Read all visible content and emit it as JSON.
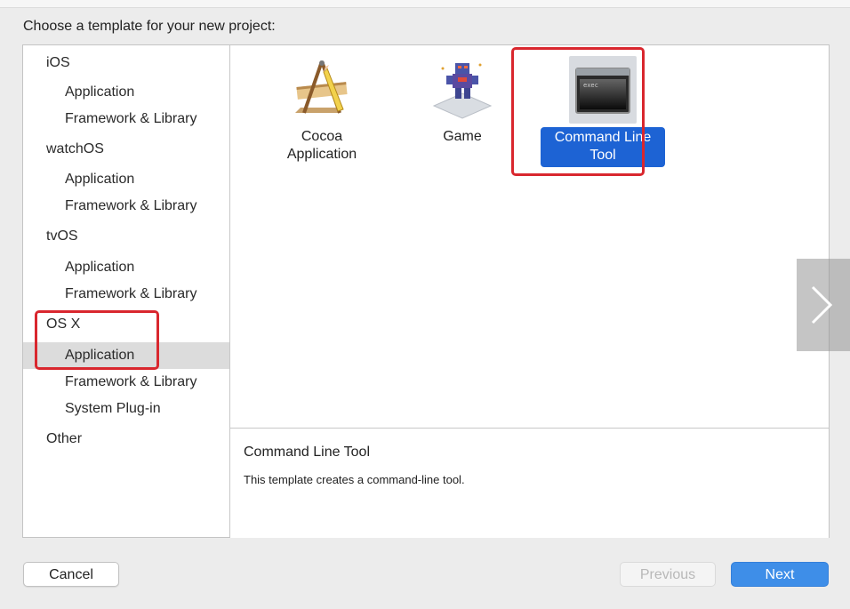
{
  "dialog": {
    "prompt": "Choose a template for your new project:"
  },
  "sidebar": {
    "items": [
      {
        "label": "iOS",
        "kind": "category"
      },
      {
        "label": "Application",
        "kind": "sub"
      },
      {
        "label": "Framework & Library",
        "kind": "sub"
      },
      {
        "label": "watchOS",
        "kind": "category"
      },
      {
        "label": "Application",
        "kind": "sub"
      },
      {
        "label": "Framework & Library",
        "kind": "sub"
      },
      {
        "label": "tvOS",
        "kind": "category"
      },
      {
        "label": "Application",
        "kind": "sub"
      },
      {
        "label": "Framework & Library",
        "kind": "sub"
      },
      {
        "label": "OS X",
        "kind": "category"
      },
      {
        "label": "Application",
        "kind": "sub",
        "selected": true
      },
      {
        "label": "Framework & Library",
        "kind": "sub"
      },
      {
        "label": "System Plug-in",
        "kind": "sub"
      },
      {
        "label": "Other",
        "kind": "category"
      }
    ]
  },
  "templates": [
    {
      "label": "Cocoa\nApplication",
      "icon": "cocoa-app-icon"
    },
    {
      "label": "Game",
      "icon": "game-icon"
    },
    {
      "label": "Command Line\nTool",
      "icon": "terminal-icon",
      "selected": true
    }
  ],
  "description": {
    "title": "Command Line Tool",
    "text": "This template creates a command-line tool."
  },
  "buttons": {
    "cancel": "Cancel",
    "previous": "Previous",
    "next": "Next"
  },
  "colors": {
    "accent": "#1d63d4",
    "next_button": "#3e8ee8",
    "highlight": "#d9272e"
  }
}
